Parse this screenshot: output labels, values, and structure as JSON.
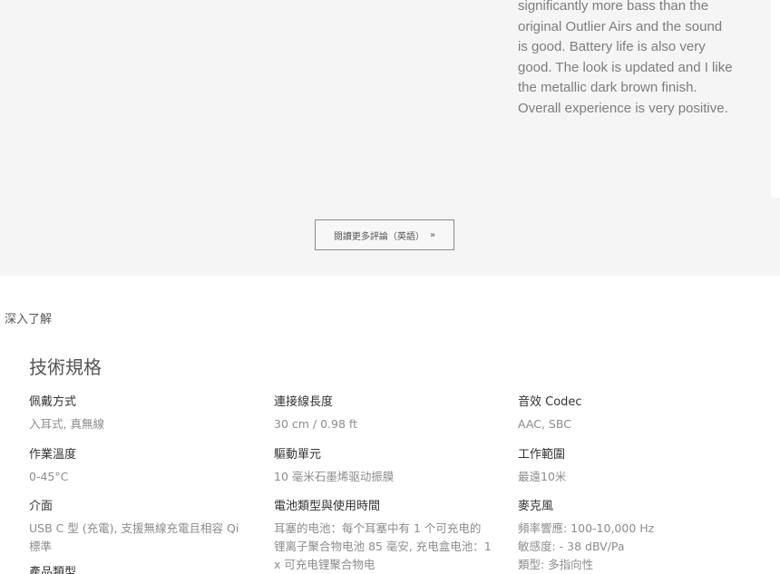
{
  "review": {
    "text": "significantly more bass than the original Outlier Airs and the sound is good. Battery life is also very good. The look is updated and I like the metallic dark brown finish. Overall experience is very positive."
  },
  "more_reviews_button": {
    "label": "閱讀更多評論（英語）",
    "chevron": "»"
  },
  "section_label": "深入了解",
  "specs": {
    "title": "技術規格",
    "columns": [
      [
        {
          "label": "佩戴方式",
          "value": "入耳式, 真無線"
        },
        {
          "label": "作業溫度",
          "value": "0-45°C"
        },
        {
          "label": "介面",
          "value": "USB C 型 (充電), 支援無線充電且相容 Qi 標準"
        },
        {
          "label": "產品類型",
          "value": ""
        }
      ],
      [
        {
          "label": "連接線長度",
          "value": "30 cm / 0.98 ft"
        },
        {
          "label": "驅動單元",
          "value": "10 毫米石墨烯驱动振膜"
        },
        {
          "label": "電池類型與使用時間",
          "value": "耳塞的电池：每个耳塞中有 1 个可充电的锂离子聚合物电池 85 毫安, 充电盒电池：1 x 可充电锂聚合物电"
        }
      ],
      [
        {
          "label": "音效 Codec",
          "value": "AAC, SBC"
        },
        {
          "label": "工作範圍",
          "value": "最遠10米"
        },
        {
          "label": "麥克風",
          "value": "頻率響應: 100-10,000 Hz\n敏感度: - 38 dBV/Pa\n類型: 多指向性"
        }
      ]
    ]
  }
}
